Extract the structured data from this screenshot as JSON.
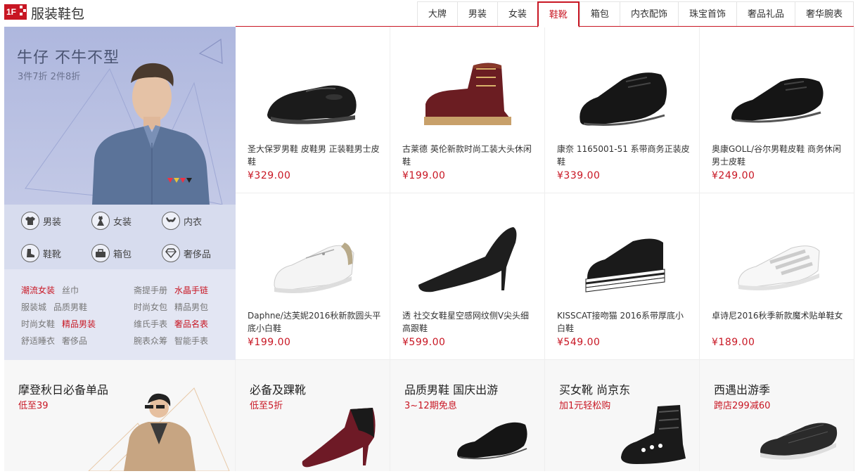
{
  "header": {
    "badge": "1F",
    "title": "服装鞋包",
    "tabs": [
      {
        "label": "大牌"
      },
      {
        "label": "男装"
      },
      {
        "label": "女装"
      },
      {
        "label": "鞋靴",
        "active": true
      },
      {
        "label": "箱包"
      },
      {
        "label": "内衣配饰"
      },
      {
        "label": "珠宝首饰"
      },
      {
        "label": "奢品礼品"
      },
      {
        "label": "奢华腕表"
      }
    ]
  },
  "banner": {
    "title": "牛仔 不牛不型",
    "subtitle": "3件7折 2件8折",
    "categories": [
      {
        "label": "男装",
        "icon": "tshirt-icon"
      },
      {
        "label": "女装",
        "icon": "dress-icon"
      },
      {
        "label": "内衣",
        "icon": "bra-icon"
      },
      {
        "label": "鞋靴",
        "icon": "boot-icon"
      },
      {
        "label": "箱包",
        "icon": "bag-icon"
      },
      {
        "label": "奢侈品",
        "icon": "diamond-icon"
      }
    ],
    "links": [
      {
        "label": "潮流女装",
        "hot": true
      },
      {
        "label": "丝巾",
        "hot": false
      },
      {
        "label": "斋提手册",
        "hot": false
      },
      {
        "label": "水晶手链",
        "hot": true
      },
      {
        "label": "服装城",
        "hot": false
      },
      {
        "label": "品质男鞋",
        "hot": false
      },
      {
        "label": "时尚女包",
        "hot": false
      },
      {
        "label": "精品男包",
        "hot": false
      },
      {
        "label": "时尚女鞋",
        "hot": false
      },
      {
        "label": "精品男装",
        "hot": true
      },
      {
        "label": "维氏手表",
        "hot": false
      },
      {
        "label": "奢品名表",
        "hot": true
      },
      {
        "label": "舒适睡衣",
        "hot": false
      },
      {
        "label": "奢侈品",
        "hot": false
      },
      {
        "label": "腕表众筹",
        "hot": false
      },
      {
        "label": "智能手表",
        "hot": false
      }
    ]
  },
  "products": [
    {
      "name": "圣大保罗男鞋 皮鞋男 正装鞋男士皮鞋",
      "price": "¥329.00"
    },
    {
      "name": "古莱德 英伦新款时尚工装大头休闲鞋",
      "price": "¥199.00"
    },
    {
      "name": "康奈 1165001-51 系带商务正装皮鞋",
      "price": "¥339.00"
    },
    {
      "name": "奥康GOLL/谷尔男鞋皮鞋 商务休闲男士皮鞋",
      "price": "¥249.00"
    },
    {
      "name": "Daphne/达芙妮2016秋新款圆头平底小白鞋",
      "price": "¥199.00"
    },
    {
      "name": "透 社交女鞋星空感网纹侧V尖头细高跟鞋",
      "price": "¥599.00"
    },
    {
      "name": "KISSCAT接吻猫 2016系带厚底小白鞋",
      "price": "¥549.00"
    },
    {
      "name": "卓诗尼2016秋季新款魔术贴单鞋女",
      "price": "¥189.00"
    }
  ],
  "promos": [
    {
      "title": "摩登秋日必备单品",
      "subtitle": "低至39"
    },
    {
      "title": "必备及踝靴",
      "subtitle": "低至5折"
    },
    {
      "title": "品质男鞋 国庆出游",
      "subtitle": "3~12期免息"
    },
    {
      "title": "买女靴  尚京东",
      "subtitle": "加1元轻松购"
    },
    {
      "title": "西遇出游季",
      "subtitle": "跨店299减60"
    }
  ]
}
